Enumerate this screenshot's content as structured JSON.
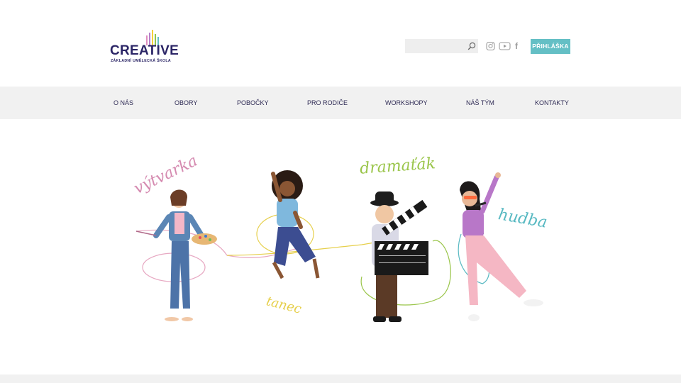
{
  "header": {
    "logo": {
      "name": "CREATIVE",
      "subtitle": "ZÁKLADNÍ UMĚLECKÁ ŠKOLA",
      "bar_colors": [
        "#e08fc0",
        "#b57fc9",
        "#f4d13a",
        "#93c64a",
        "#64bfc5"
      ]
    },
    "search": {
      "value": "",
      "placeholder": "",
      "icon": "search-icon"
    },
    "social": [
      {
        "name": "instagram-icon"
      },
      {
        "name": "youtube-icon"
      },
      {
        "name": "facebook-icon",
        "glyph": "f"
      }
    ],
    "apply_label": "PŘIHLÁŠKA"
  },
  "nav": {
    "items": [
      {
        "label": "O NÁS"
      },
      {
        "label": "OBORY"
      },
      {
        "label": "POBOČKY"
      },
      {
        "label": "PRO RODIČE"
      },
      {
        "label": "WORKSHOPY"
      },
      {
        "label": "NÁŠ TÝM"
      },
      {
        "label": "KONTAKTY"
      }
    ]
  },
  "hero": {
    "words": {
      "art": "výtvarka",
      "dance": "tanec",
      "drama": "dramaťák",
      "music": "hudba"
    }
  },
  "colors": {
    "brand": "#2b2566",
    "accent": "#64bfc5",
    "nav_bg": "#f1f1f1",
    "pink": "#d58ab0",
    "yellow": "#e6cf4a",
    "green": "#9ac54a",
    "teal": "#58b9c2"
  }
}
